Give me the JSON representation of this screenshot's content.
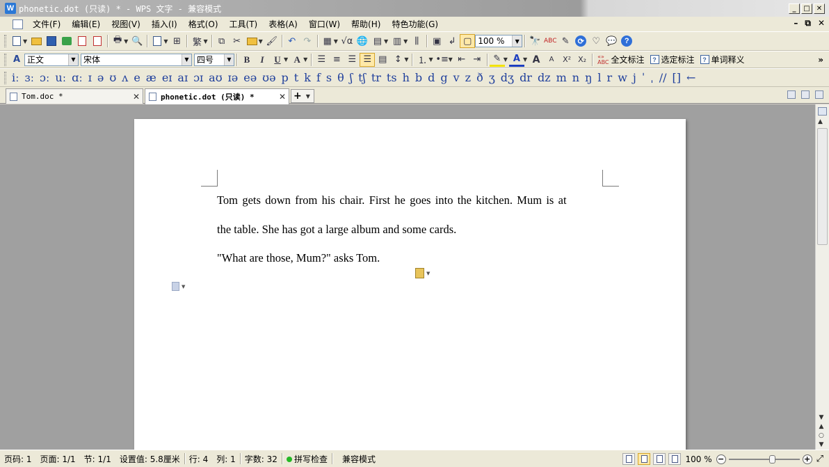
{
  "window": {
    "title": "phonetic.dot (只读) * - WPS 文字 - 兼容模式",
    "app_icon_letter": "W",
    "buttons": [
      "_",
      "□",
      "✕"
    ]
  },
  "menubar": {
    "items": [
      "文件(F)",
      "编辑(E)",
      "视图(V)",
      "插入(I)",
      "格式(O)",
      "工具(T)",
      "表格(A)",
      "窗口(W)",
      "帮助(H)",
      "特色功能(G)"
    ],
    "right_controls": [
      "–",
      "⧉",
      "✕"
    ]
  },
  "toolbar_standard": {
    "zoom_value": "100 %",
    "icons": [
      "new-icon",
      "open-icon",
      "save-icon",
      "send-mail-icon",
      "export-pdf-icon",
      "pdf-icon",
      "print-icon",
      "print-preview-icon",
      "insert-page-icon",
      "format-painter-icon",
      "traditional-chinese-icon",
      "copy-icon",
      "cut-icon",
      "paste-icon",
      "eraser-icon",
      "undo-icon",
      "redo-icon",
      "insert-table-icon",
      "formula-icon",
      "hyperlink-icon",
      "table-icon",
      "columns-icon",
      "align-icon",
      "text-box-icon",
      "show-marks-icon",
      "page-view-icon",
      "find-icon",
      "spellcheck-icon",
      "drawing-icon",
      "online-icon",
      "template-icon",
      "chat-icon",
      "help-icon"
    ],
    "traditional_label": "繁"
  },
  "toolbar_format": {
    "style_value": "正文",
    "font_value": "宋体",
    "size_value": "四号",
    "bold": "B",
    "italic": "I",
    "underline": "U",
    "font_color_letter": "A",
    "grow": "A",
    "shrink": "A",
    "superscript": "X²",
    "subscript": "X₂",
    "full_annotate_label": "全文标注",
    "selected_annotate_label": "选定标注",
    "word_meaning_label": "单词释义",
    "overflow": "»"
  },
  "phonetic_bar": {
    "symbols": [
      "iː",
      "ɜː",
      "ɔː",
      "uː",
      "ɑː",
      "ɪ",
      "ə",
      "ʊ",
      "ʌ",
      "e",
      "æ",
      "eɪ",
      "aɪ",
      "ɔɪ",
      "aʊ",
      "ɪə",
      "eə",
      "ʊə",
      "p",
      "t",
      "k",
      "f",
      "s",
      "θ",
      "ʃ",
      "tʃ",
      "tr",
      "ts",
      "h",
      "b",
      "d",
      "g",
      "v",
      "z",
      "ð",
      "ʒ",
      "dʒ",
      "dr",
      "dz",
      "m",
      "n",
      "ŋ",
      "l",
      "r",
      "w",
      "j",
      "ˈ",
      "ˌ",
      "//",
      "[]",
      "←"
    ]
  },
  "tabs": [
    {
      "label": "Tom.doc *",
      "active": false
    },
    {
      "label": "phonetic.dot (只读) *",
      "active": true
    }
  ],
  "tab_add_label": "+",
  "document": {
    "paragraphs": [
      "Tom gets down from his chair. First he goes into the kitchen. Mum is at",
      "the table. She has got a large album and some cards.",
      "\"What are those, Mum?\" asks Tom."
    ]
  },
  "statusbar": {
    "page_code": "页码: 1",
    "pages": "页面: 1/1",
    "section": "节: 1/1",
    "setting": "设置值: 5.8厘米",
    "row": "行: 4",
    "col": "列: 1",
    "word_count": "字数: 32",
    "spellcheck": "拼写检查",
    "compat_mode": "兼容模式",
    "zoom": "100 %"
  },
  "colors": {
    "ui_background": "#ece9d8",
    "doc_background": "#a0a0a0",
    "phonetic_text": "#1f3f9c",
    "spellcheck_dot": "#25b825"
  }
}
